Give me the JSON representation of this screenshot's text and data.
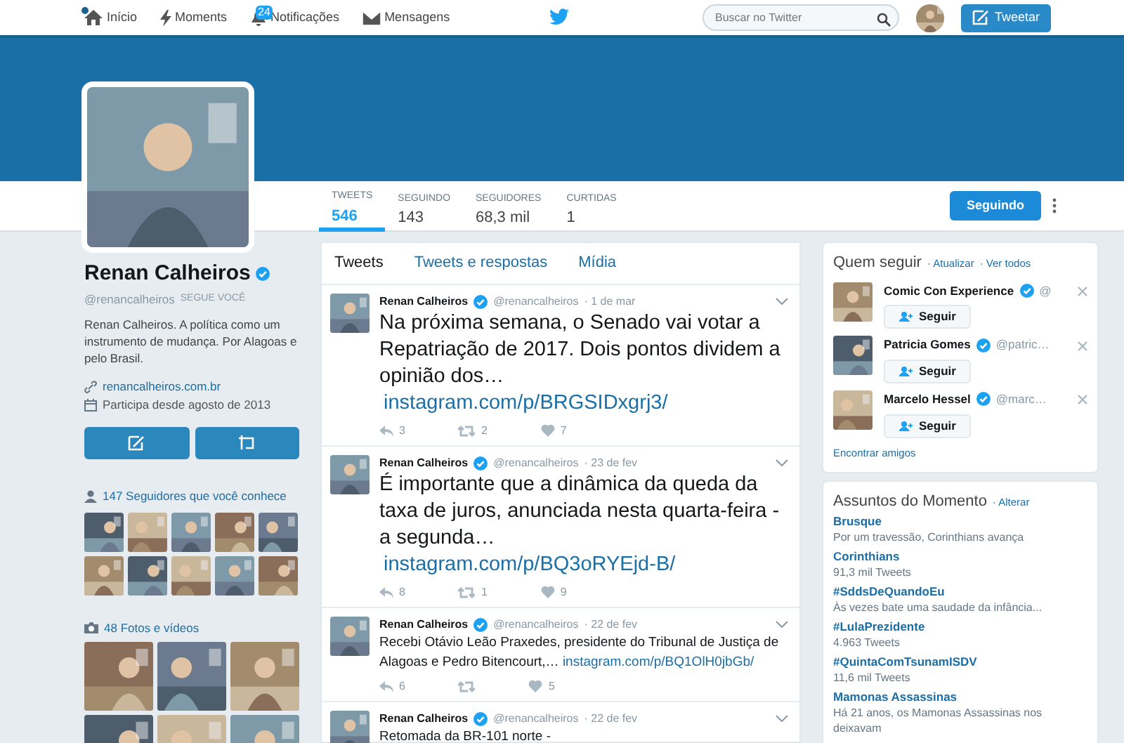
{
  "nav": {
    "items": [
      {
        "kind": "home",
        "label": "Início",
        "dot": true
      },
      {
        "kind": "moments",
        "label": "Moments"
      },
      {
        "kind": "notifications",
        "label": "Notificações",
        "badge": "24"
      },
      {
        "kind": "messages",
        "label": "Mensagens"
      }
    ],
    "search": {
      "placeholder": "Buscar no Twitter"
    },
    "tweet_button": "Tweetar"
  },
  "profile": {
    "name": "Renan Calheiros",
    "handle": "@renancalheiros",
    "follows_you": "SEGUE VOCÊ",
    "bio": "Renan Calheiros. A política como um instrumento de mudança. Por Alagoas e pelo Brasil.",
    "link": "renancalheiros.com.br",
    "joined": "Participa desde agosto de 2013",
    "stats": [
      {
        "label": "TWEETS",
        "value": "546",
        "selected": true
      },
      {
        "label": "SEGUINDO",
        "value": "143",
        "selected": false
      },
      {
        "label": "SEGUIDORES",
        "value": "68,3 mil",
        "selected": false
      },
      {
        "label": "CURTIDAS",
        "value": "1",
        "selected": false
      }
    ],
    "follow_button": "Seguindo"
  },
  "followers_known": {
    "label": "147 Seguidores que você conhece"
  },
  "media": {
    "label": "48 Fotos e vídeos"
  },
  "tabs": [
    {
      "label": "Tweets",
      "selected": true
    },
    {
      "label": "Tweets e respostas",
      "selected": false
    },
    {
      "label": "Mídia",
      "selected": false
    }
  ],
  "tweets": [
    {
      "kind": "large",
      "name": "Renan Calheiros",
      "handle": "@renancalheiros",
      "date": "· 1 de mar",
      "text": "Na próxima semana, o Senado vai votar a Repatriação de 2017. Dois pontos dividem a opinião dos…",
      "link": "instagram.com/p/BRGSIDxgrj3/",
      "replies": "3",
      "retweets": "2",
      "likes": "7"
    },
    {
      "kind": "large",
      "name": "Renan Calheiros",
      "handle": "@renancalheiros",
      "date": "· 23 de fev",
      "text": "É importante que a dinâmica da queda da taxa de juros, anunciada nesta quarta-feira - a segunda…",
      "link": "instagram.com/p/BQ3oRYEjd-B/",
      "replies": "8",
      "retweets": "1",
      "likes": "9"
    },
    {
      "kind": "normal",
      "name": "Renan Calheiros",
      "handle": "@renancalheiros",
      "date": "· 22 de fev",
      "text": "Recebi Otávio Leão Praxedes, presidente do Tribunal de Justiça de Alagoas e Pedro Bitencourt,…",
      "link": "instagram.com/p/BQ1OlH0jbGb/",
      "replies": "6",
      "likes": "5"
    },
    {
      "kind": "normal",
      "name": "Renan Calheiros",
      "handle": "@renancalheiros",
      "date": "· 22 de fev",
      "text": "Retomada da BR-101 norte -"
    }
  ],
  "who_to_follow": {
    "title": "Quem seguir",
    "refresh": "· Atualizar",
    "view_all": "· Ver todos",
    "users": [
      {
        "name": "Comic Con Experience",
        "handle": "@",
        "button": "Seguir"
      },
      {
        "name": "Patricia Gomes",
        "handle": "@patric…",
        "button": "Seguir"
      },
      {
        "name": "Marcelo Hessel",
        "handle": "@marc…",
        "button": "Seguir"
      }
    ],
    "find": "Encontrar amigos"
  },
  "trends": {
    "title": "Assuntos do Momento",
    "change": "· Alterar",
    "items": [
      {
        "name": "Brusque",
        "detail": "Por um travessão, Corinthians avança"
      },
      {
        "name": "Corinthians",
        "detail": "91,3 mil Tweets"
      },
      {
        "name": "#SddsDeQuandoEu",
        "detail": "Às vezes bate uma saudade da infância..."
      },
      {
        "name": "#LulaPrezidente",
        "detail": "4.963 Tweets"
      },
      {
        "name": "#QuintaComTsunamISDV",
        "detail": "11,6 mil Tweets"
      },
      {
        "name": "Mamonas Assassinas",
        "detail": "Há 21 anos, os Mamonas Assassinas nos deixavam"
      }
    ]
  }
}
